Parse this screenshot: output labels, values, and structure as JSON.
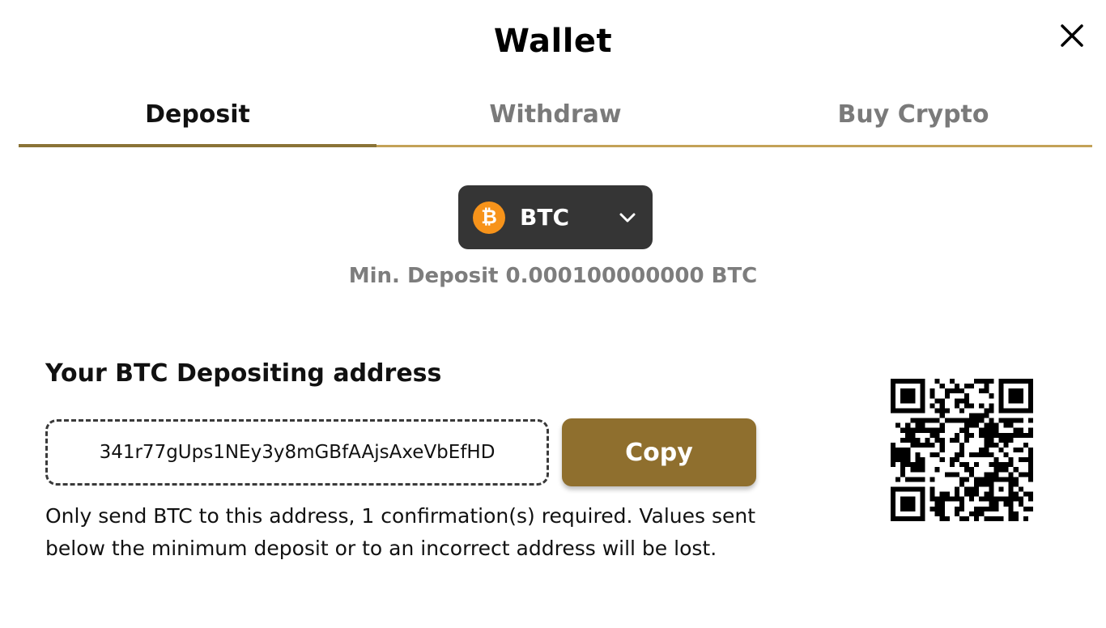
{
  "modal": {
    "title": "Wallet"
  },
  "tabs": [
    {
      "label": "Deposit",
      "active": true
    },
    {
      "label": "Withdraw",
      "active": false
    },
    {
      "label": "Buy Crypto",
      "active": false
    }
  ],
  "coin_selector": {
    "symbol": "BTC",
    "icon": "bitcoin-icon",
    "icon_color": "#f7931a"
  },
  "min_deposit": "Min. Deposit 0.000100000000 BTC",
  "address_section": {
    "heading": "Your BTC Depositing address",
    "address": "341r77gUps1NEy3y8mGBfAAjsAxeVbEfHD",
    "copy_label": "Copy",
    "notice": "Only send BTC to this address, 1 confirmation(s) required. Values sent below the minimum deposit or to an incorrect address will be lost."
  },
  "colors": {
    "accent": "#8f6f2e",
    "tab_underline": "#c3a257",
    "selector_bg": "#353535"
  }
}
